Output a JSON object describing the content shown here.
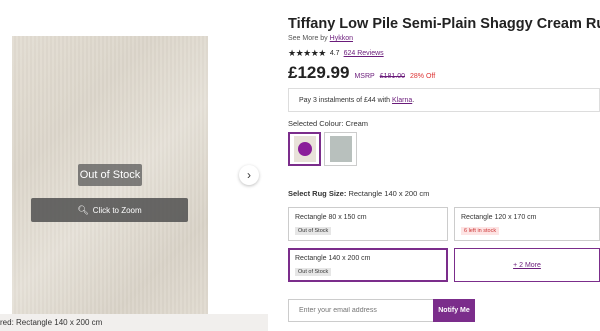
{
  "gallery": {
    "out_of_stock": "Out of Stock",
    "zoom_label": "Click to Zoom",
    "caption": "red: Rectangle 140 x 200 cm",
    "next_arrow": "›"
  },
  "product": {
    "title": "Tiffany Low Pile Semi-Plain Shaggy Cream Rug",
    "see_more_prefix": "See More by",
    "brand": "Hykkon",
    "stars": "★★★★★",
    "rating": "4.7",
    "reviews": "624 Reviews",
    "price": "£129.99",
    "msrp_label": "MSRP",
    "msrp_value": "£181.00",
    "discount": "28% Off"
  },
  "klarna": {
    "text": "Pay 3 instalments of £44 with",
    "link": "Klarna",
    "suffix": "."
  },
  "colour": {
    "label": "Selected Colour: Cream",
    "swatches": [
      "Cream",
      "Grey"
    ]
  },
  "size": {
    "label_bold": "Select Rug Size:",
    "label_value": "Rectangle 140 x 200 cm",
    "options": [
      {
        "name": "Rectangle 80 x 150 cm",
        "tag": "Out of Stock"
      },
      {
        "name": "Rectangle 120 x 170 cm",
        "tag": "6 left in stock"
      },
      {
        "name": "Rectangle 140 x 200 cm",
        "tag": "Out of Stock"
      }
    ],
    "more": "+ 2 More"
  },
  "notify": {
    "placeholder": "Enter your email address",
    "button": "Notify Me"
  },
  "colors": {
    "accent": "#7b2d8b",
    "link": "#6a1b7a",
    "discount": "#dd3333"
  }
}
